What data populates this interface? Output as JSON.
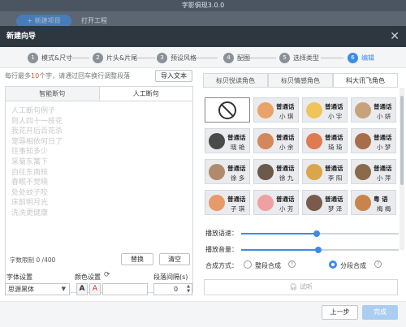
{
  "app": {
    "title": "字影俱现3.0.0",
    "new_project_label": "+ 新建项目",
    "open_project_label": "打开工程"
  },
  "dialog": {
    "title": "新建向导",
    "close_icon": "close-icon",
    "steps": [
      {
        "num": "1",
        "label": "模式&尺寸"
      },
      {
        "num": "2",
        "label": "片头&片尾"
      },
      {
        "num": "3",
        "label": "预设风格"
      },
      {
        "num": "4",
        "label": "配图"
      },
      {
        "num": "5",
        "label": "选择类型"
      },
      {
        "num": "6",
        "label": "编辑"
      }
    ],
    "active_step": 6
  },
  "left": {
    "hint_prefix": "每行最多",
    "hint_count": "10",
    "hint_suffix": "个字，请通过回车换行调整段落",
    "import_label": "导入文本",
    "tabs": [
      "智能断句",
      "人工断句"
    ],
    "active_tab": 1,
    "placeholder_lines": [
      "人工断句例子",
      "则人四十一枝花",
      "我花开后百花杀",
      "宠辱相依何日了",
      "往事知多少",
      "采菊东篱下",
      "自往东南枝",
      "春眠不觉晓",
      "处处蚊子咬",
      "床前明月光",
      "洗洗更健康"
    ],
    "char_limit_label": "字数限制",
    "char_limit_value": "0 /400",
    "replace_label": "替换",
    "clear_label": "清空",
    "font_label": "字体设置",
    "font_value": "思源黑体",
    "color_label": "颜色设置",
    "color_a": "A",
    "pause_label": "段落间隔(s)",
    "pause_value": "0"
  },
  "right": {
    "tabs": [
      "标贝悦读角色",
      "标贝情感角色",
      "科大讯飞角色"
    ],
    "active_tab": 2,
    "voices": [
      {
        "line1": "",
        "line2": "",
        "type": "none",
        "color": ""
      },
      {
        "line1": "普通话",
        "line2": "小 琪",
        "color": "#e8a26a"
      },
      {
        "line1": "普通话",
        "line2": "小 宇",
        "color": "#f0c45a"
      },
      {
        "line1": "普通话",
        "line2": "小 妍",
        "color": "#c9a27a"
      },
      {
        "line1": "普通话",
        "line2": "晓 艳",
        "color": "#4a4a4a"
      },
      {
        "line1": "普通话",
        "line2": "小 余",
        "color": "#d3875a"
      },
      {
        "line1": "普通话",
        "line2": "琦 琦",
        "color": "#e07a50"
      },
      {
        "line1": "普通话",
        "line2": "小 梦",
        "color": "#a86e4a"
      },
      {
        "line1": "普通话",
        "line2": "徐 多",
        "color": "#b08a6a"
      },
      {
        "line1": "普通话",
        "line2": "徐 九",
        "color": "#6b5a4a"
      },
      {
        "line1": "普通话",
        "line2": "李 阳",
        "color": "#d9a64a"
      },
      {
        "line1": "普通话",
        "line2": "小 萍",
        "color": "#8a6a4a"
      },
      {
        "line1": "普通话",
        "line2": "子 琪",
        "color": "#e69a6a"
      },
      {
        "line1": "普通话",
        "line2": "小 芳",
        "color": "#f0a0a0"
      },
      {
        "line1": "普通话",
        "line2": "梦 泽",
        "color": "#7a5a4a"
      },
      {
        "line1": "粤 语",
        "line2": "梅 梅",
        "color": "#c8844a"
      }
    ],
    "speed_label": "播放语速：",
    "speed_value": 0.48,
    "volume_label": "播放音量：",
    "volume_value": 0.49,
    "mode_label": "合成方式：",
    "mode_options": [
      "整段合成",
      "分段合成"
    ],
    "mode_selected": 1,
    "listen_label": "试听",
    "listen_icon": "headphone-icon"
  },
  "footer": {
    "prev_label": "上一步",
    "next_label": "完成"
  }
}
